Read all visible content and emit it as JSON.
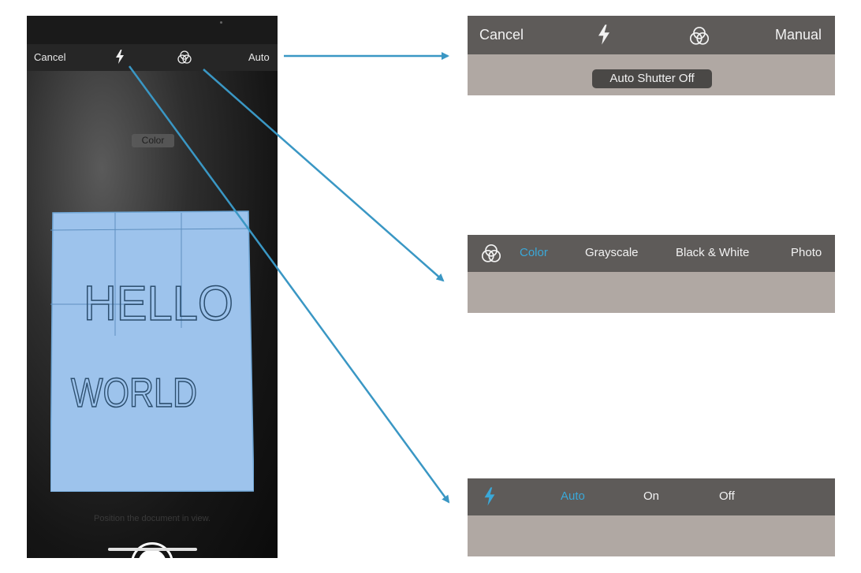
{
  "phone": {
    "toolbar": {
      "cancel_label": "Cancel",
      "flash_mode_label": "Auto"
    },
    "color_mode_chip": "Color",
    "handwriting": {
      "line1": "HELLO",
      "line2": "WORLD"
    },
    "hint": "Position the document in view."
  },
  "panel_shutter": {
    "cancel_label": "Cancel",
    "manual_label": "Manual",
    "auto_shutter_pill": "Auto Shutter Off"
  },
  "panel_filter": {
    "options": [
      "Color",
      "Grayscale",
      "Black & White",
      "Photo"
    ],
    "selected": "Color"
  },
  "panel_flash": {
    "options": [
      "Auto",
      "On",
      "Off"
    ],
    "selected": "Auto"
  },
  "colors": {
    "accent": "#3aa8d8",
    "arrow": "#3a97c4",
    "document_overlay": "#9dc3ec",
    "panel_bar": "#5e5b59",
    "panel_body": "#b0a8a3"
  },
  "icons": [
    "flash-icon",
    "color-filter-icon",
    "shutter-button"
  ]
}
